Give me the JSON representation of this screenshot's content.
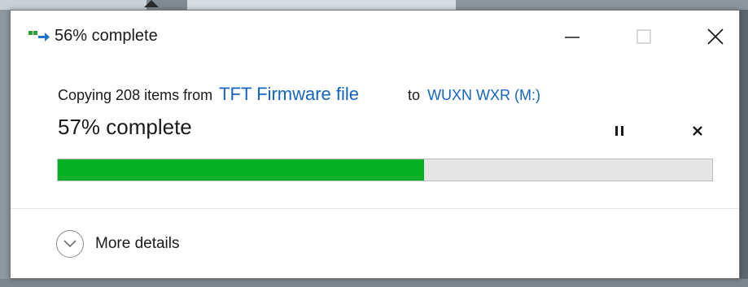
{
  "window": {
    "title": "56% complete",
    "minimize_icon": "minimize-icon",
    "maximize_icon": "maximize-icon",
    "close_icon": "close-icon"
  },
  "copy": {
    "prefix": "Copying 208 items from",
    "source": "TFT Firmware file",
    "to_label": "to",
    "destination": "WUXN WXR (M:)"
  },
  "progress": {
    "label": "57% complete",
    "fraction": 0.56,
    "fill_color": "#06b025",
    "track_color": "#e6e6e6"
  },
  "controls": {
    "pause_icon": "pause-icon",
    "cancel_icon": "cancel-icon"
  },
  "footer": {
    "details_label": "More details",
    "details_icon": "chevron-down-circle-icon"
  },
  "colors": {
    "link": "#1565c0",
    "text": "#1a1a1a"
  }
}
